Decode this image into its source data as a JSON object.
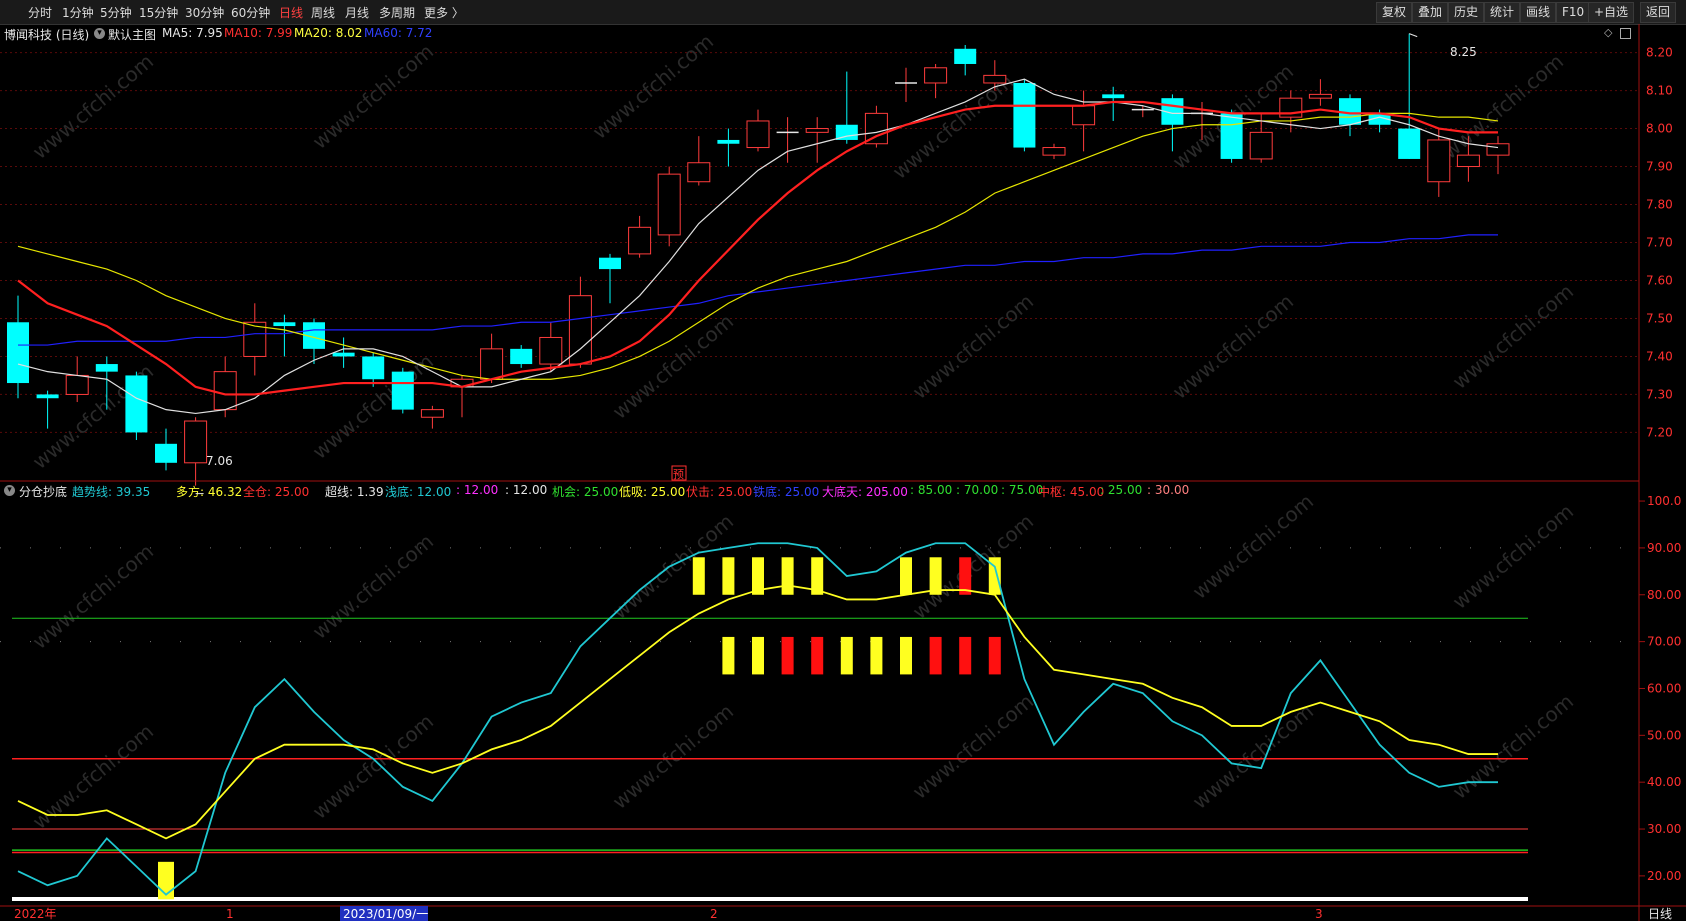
{
  "toolbar": {
    "periods": [
      "分时",
      "1分钟",
      "5分钟",
      "15分钟",
      "30分钟",
      "60分钟",
      "日线",
      "周线",
      "月线",
      "多周期",
      "更多 〉"
    ],
    "active_index": 6,
    "right_buttons": [
      "复权",
      "叠加",
      "历史",
      "统计",
      "画线",
      "F10",
      "+自选",
      "返回"
    ]
  },
  "main_chart": {
    "stock_title": "博闻科技 (日线)",
    "template_label": "默认主图",
    "ma5": "MA5: 7.95",
    "ma10": "MA10: 7.99",
    "ma20": "MA20: 8.02",
    "ma60": "MA60: 7.72",
    "high_label": "8.25",
    "low_label": "7.06",
    "axis_ticks": [
      "8.20",
      "8.10",
      "8.00",
      "7.90",
      "7.80",
      "7.70",
      "7.60",
      "7.50",
      "7.40",
      "7.30",
      "7.20"
    ],
    "forecast_mark": "预",
    "watermark": "www.cfchi.com"
  },
  "indicator": {
    "name": "分仓抄底",
    "trend": "趋势线: 39.35",
    "duofang": "多方: 46.32",
    "quancang": "全仓: 25.00",
    "chaoxian": "超线: 1.39",
    "qiandi": "浅底: 12.00",
    "v1": ": 12.00",
    "v2": ": 12.00",
    "jihui": "机会: 25.00",
    "dixi": "低吸: 25.00",
    "fuji": "伏击: 25.00",
    "tiedi": "铁底: 25.00",
    "dadiantian": "大底天: 205.00",
    "v3": ": 85.00",
    "v4": ": 70.00",
    "v5": ": 75.00",
    "zhongshu": "中枢: 45.00",
    "v6": ": 25.00",
    "v7": ": 30.00",
    "axis_ticks": [
      "100.0",
      "90.00",
      "80.00",
      "70.00",
      "60.00",
      "50.00",
      "40.00",
      "30.00",
      "20.00"
    ]
  },
  "bottom_axis": {
    "labels": [
      "2022年",
      "1",
      "2023/01/09/一",
      "2",
      "3"
    ],
    "period_tab": "日线"
  },
  "colors": {
    "up": "#ff3c3c",
    "down": "#00ffff",
    "ma5": "#e0e0e0",
    "ma10": "#ff2020",
    "ma20": "#e6e600",
    "ma60": "#2020ff",
    "trend": "#20c8d2",
    "duofang": "#ffff20"
  },
  "chart_data": [
    {
      "type": "candlestick",
      "ylim": [
        7.08,
        8.27
      ],
      "candles": [
        [
          7.49,
          7.33,
          7.56,
          7.29
        ],
        [
          7.3,
          7.29,
          7.31,
          7.21
        ],
        [
          7.3,
          7.35,
          7.4,
          7.28
        ],
        [
          7.38,
          7.36,
          7.4,
          7.26
        ],
        [
          7.35,
          7.2,
          7.36,
          7.18
        ],
        [
          7.17,
          7.12,
          7.21,
          7.1
        ],
        [
          7.12,
          7.23,
          7.24,
          7.06
        ],
        [
          7.26,
          7.36,
          7.4,
          7.24
        ],
        [
          7.4,
          7.49,
          7.54,
          7.35
        ],
        [
          7.49,
          7.48,
          7.51,
          7.4
        ],
        [
          7.49,
          7.42,
          7.5,
          7.38
        ],
        [
          7.41,
          7.4,
          7.45,
          7.37
        ],
        [
          7.4,
          7.34,
          7.41,
          7.32
        ],
        [
          7.36,
          7.26,
          7.37,
          7.25
        ],
        [
          7.24,
          7.26,
          7.27,
          7.21
        ],
        [
          7.32,
          7.34,
          7.35,
          7.24
        ],
        [
          7.34,
          7.42,
          7.46,
          7.33
        ],
        [
          7.42,
          7.38,
          7.43,
          7.37
        ],
        [
          7.38,
          7.45,
          7.49,
          7.36
        ],
        [
          7.38,
          7.56,
          7.61,
          7.37
        ],
        [
          7.66,
          7.63,
          7.67,
          7.54
        ],
        [
          7.67,
          7.74,
          7.77,
          7.66
        ],
        [
          7.72,
          7.88,
          7.9,
          7.69
        ],
        [
          7.86,
          7.91,
          7.98,
          7.85
        ],
        [
          7.97,
          7.96,
          8.0,
          7.9
        ],
        [
          7.95,
          8.02,
          8.05,
          7.94
        ],
        [
          7.99,
          7.99,
          8.03,
          7.91
        ],
        [
          7.99,
          8.0,
          8.03,
          7.91
        ],
        [
          8.01,
          7.97,
          8.15,
          7.96
        ],
        [
          7.96,
          8.04,
          8.06,
          7.95
        ],
        [
          8.12,
          8.12,
          8.16,
          8.07
        ],
        [
          8.12,
          8.16,
          8.17,
          8.08
        ],
        [
          8.21,
          8.17,
          8.22,
          8.14
        ],
        [
          8.12,
          8.14,
          8.18,
          8.1
        ],
        [
          8.12,
          7.95,
          8.13,
          7.94
        ],
        [
          7.93,
          7.95,
          7.96,
          7.92
        ],
        [
          8.01,
          8.06,
          8.1,
          7.94
        ],
        [
          8.09,
          8.08,
          8.11,
          8.02
        ],
        [
          8.05,
          8.05,
          8.06,
          8.03
        ],
        [
          8.08,
          8.01,
          8.09,
          7.94
        ],
        [
          8.04,
          8.04,
          8.07,
          7.97
        ],
        [
          8.04,
          7.92,
          8.05,
          7.91
        ],
        [
          7.92,
          7.99,
          8.04,
          7.91
        ],
        [
          8.03,
          8.08,
          8.1,
          7.99
        ],
        [
          8.08,
          8.09,
          8.13,
          8.06
        ],
        [
          8.08,
          8.01,
          8.09,
          7.98
        ],
        [
          8.04,
          8.01,
          8.05,
          7.99
        ],
        [
          8.0,
          7.92,
          8.25,
          7.92
        ],
        [
          7.86,
          7.97,
          8.0,
          7.82
        ],
        [
          7.9,
          7.93,
          7.98,
          7.86
        ],
        [
          7.93,
          7.96,
          7.98,
          7.88
        ]
      ],
      "ma5": [
        7.38,
        7.36,
        7.35,
        7.34,
        7.29,
        7.26,
        7.25,
        7.26,
        7.29,
        7.35,
        7.39,
        7.42,
        7.42,
        7.4,
        7.36,
        7.32,
        7.32,
        7.34,
        7.36,
        7.42,
        7.49,
        7.56,
        7.65,
        7.75,
        7.82,
        7.89,
        7.94,
        7.96,
        7.98,
        7.99,
        8.01,
        8.04,
        8.07,
        8.11,
        8.13,
        8.09,
        8.07,
        8.07,
        8.06,
        8.04,
        8.04,
        8.03,
        8.02,
        8.01,
        8.0,
        8.01,
        8.03,
        8.01,
        7.98,
        7.96,
        7.95
      ],
      "ma10": [
        7.6,
        7.54,
        7.51,
        7.48,
        7.43,
        7.38,
        7.32,
        7.3,
        7.3,
        7.31,
        7.32,
        7.33,
        7.33,
        7.33,
        7.33,
        7.32,
        7.34,
        7.36,
        7.37,
        7.38,
        7.4,
        7.44,
        7.51,
        7.6,
        7.68,
        7.76,
        7.83,
        7.89,
        7.94,
        7.98,
        8.01,
        8.03,
        8.05,
        8.06,
        8.06,
        8.06,
        8.06,
        8.07,
        8.07,
        8.06,
        8.05,
        8.04,
        8.04,
        8.04,
        8.05,
        8.04,
        8.04,
        8.03,
        8.0,
        7.99,
        7.99
      ],
      "ma20": [
        7.69,
        7.67,
        7.65,
        7.63,
        7.6,
        7.56,
        7.53,
        7.5,
        7.48,
        7.47,
        7.45,
        7.43,
        7.41,
        7.39,
        7.37,
        7.35,
        7.34,
        7.34,
        7.34,
        7.35,
        7.37,
        7.4,
        7.44,
        7.49,
        7.54,
        7.58,
        7.61,
        7.63,
        7.65,
        7.68,
        7.71,
        7.74,
        7.78,
        7.83,
        7.86,
        7.89,
        7.92,
        7.95,
        7.98,
        8.0,
        8.01,
        8.01,
        8.02,
        8.02,
        8.03,
        8.03,
        8.04,
        8.04,
        8.03,
        8.03,
        8.02
      ],
      "ma60": [
        7.43,
        7.43,
        7.44,
        7.44,
        7.44,
        7.44,
        7.45,
        7.45,
        7.46,
        7.46,
        7.47,
        7.47,
        7.47,
        7.47,
        7.47,
        7.48,
        7.48,
        7.49,
        7.49,
        7.5,
        7.51,
        7.52,
        7.53,
        7.54,
        7.56,
        7.57,
        7.58,
        7.59,
        7.6,
        7.61,
        7.62,
        7.63,
        7.64,
        7.64,
        7.65,
        7.65,
        7.66,
        7.66,
        7.67,
        7.67,
        7.68,
        7.68,
        7.69,
        7.69,
        7.69,
        7.7,
        7.7,
        7.71,
        7.71,
        7.72,
        7.72
      ]
    },
    {
      "type": "line",
      "ylim": [
        14,
        103
      ],
      "trend": [
        21,
        18,
        20,
        28,
        22,
        16,
        21,
        42,
        56,
        62,
        55,
        49,
        45,
        39,
        36,
        44,
        54,
        57,
        59,
        69,
        75,
        81,
        86,
        89,
        90,
        91,
        91,
        90,
        84,
        85,
        89,
        91,
        91,
        86,
        62,
        48,
        55,
        61,
        59,
        53,
        50,
        44,
        43,
        59,
        66,
        57,
        48,
        42,
        39,
        40,
        40
      ],
      "duofang": [
        36,
        33,
        33,
        34,
        31,
        28,
        31,
        38,
        45,
        48,
        48,
        48,
        47,
        44,
        42,
        44,
        47,
        49,
        52,
        57,
        62,
        67,
        72,
        76,
        79,
        81,
        82,
        81,
        79,
        79,
        80,
        81,
        81,
        80,
        71,
        64,
        63,
        62,
        61,
        58,
        56,
        52,
        52,
        55,
        57,
        55,
        53,
        49,
        48,
        46,
        46
      ],
      "horizontal_lines": [
        75,
        45,
        30,
        25.5,
        25
      ],
      "markers_row1": [
        "Y",
        "Y",
        "Y",
        "Y",
        "Y",
        null,
        null,
        "Y",
        "Y",
        "R",
        "Y"
      ],
      "markers_row2": [
        "Y",
        "Y",
        "R",
        "R",
        "Y",
        "Y",
        "Y",
        "R",
        "R",
        "R"
      ]
    }
  ]
}
